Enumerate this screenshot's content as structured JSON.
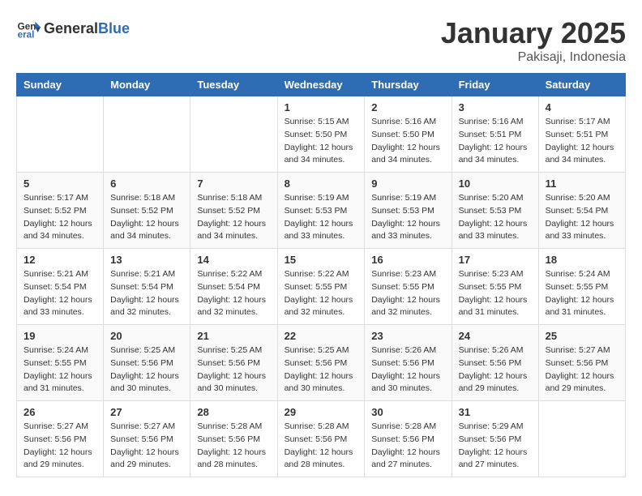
{
  "header": {
    "logo_general": "General",
    "logo_blue": "Blue",
    "title": "January 2025",
    "location": "Pakisaji, Indonesia"
  },
  "weekdays": [
    "Sunday",
    "Monday",
    "Tuesday",
    "Wednesday",
    "Thursday",
    "Friday",
    "Saturday"
  ],
  "weeks": [
    [
      {
        "day": "",
        "sunrise": "",
        "sunset": "",
        "daylight": ""
      },
      {
        "day": "",
        "sunrise": "",
        "sunset": "",
        "daylight": ""
      },
      {
        "day": "",
        "sunrise": "",
        "sunset": "",
        "daylight": ""
      },
      {
        "day": "1",
        "sunrise": "Sunrise: 5:15 AM",
        "sunset": "Sunset: 5:50 PM",
        "daylight": "Daylight: 12 hours and 34 minutes."
      },
      {
        "day": "2",
        "sunrise": "Sunrise: 5:16 AM",
        "sunset": "Sunset: 5:50 PM",
        "daylight": "Daylight: 12 hours and 34 minutes."
      },
      {
        "day": "3",
        "sunrise": "Sunrise: 5:16 AM",
        "sunset": "Sunset: 5:51 PM",
        "daylight": "Daylight: 12 hours and 34 minutes."
      },
      {
        "day": "4",
        "sunrise": "Sunrise: 5:17 AM",
        "sunset": "Sunset: 5:51 PM",
        "daylight": "Daylight: 12 hours and 34 minutes."
      }
    ],
    [
      {
        "day": "5",
        "sunrise": "Sunrise: 5:17 AM",
        "sunset": "Sunset: 5:52 PM",
        "daylight": "Daylight: 12 hours and 34 minutes."
      },
      {
        "day": "6",
        "sunrise": "Sunrise: 5:18 AM",
        "sunset": "Sunset: 5:52 PM",
        "daylight": "Daylight: 12 hours and 34 minutes."
      },
      {
        "day": "7",
        "sunrise": "Sunrise: 5:18 AM",
        "sunset": "Sunset: 5:52 PM",
        "daylight": "Daylight: 12 hours and 34 minutes."
      },
      {
        "day": "8",
        "sunrise": "Sunrise: 5:19 AM",
        "sunset": "Sunset: 5:53 PM",
        "daylight": "Daylight: 12 hours and 33 minutes."
      },
      {
        "day": "9",
        "sunrise": "Sunrise: 5:19 AM",
        "sunset": "Sunset: 5:53 PM",
        "daylight": "Daylight: 12 hours and 33 minutes."
      },
      {
        "day": "10",
        "sunrise": "Sunrise: 5:20 AM",
        "sunset": "Sunset: 5:53 PM",
        "daylight": "Daylight: 12 hours and 33 minutes."
      },
      {
        "day": "11",
        "sunrise": "Sunrise: 5:20 AM",
        "sunset": "Sunset: 5:54 PM",
        "daylight": "Daylight: 12 hours and 33 minutes."
      }
    ],
    [
      {
        "day": "12",
        "sunrise": "Sunrise: 5:21 AM",
        "sunset": "Sunset: 5:54 PM",
        "daylight": "Daylight: 12 hours and 33 minutes."
      },
      {
        "day": "13",
        "sunrise": "Sunrise: 5:21 AM",
        "sunset": "Sunset: 5:54 PM",
        "daylight": "Daylight: 12 hours and 32 minutes."
      },
      {
        "day": "14",
        "sunrise": "Sunrise: 5:22 AM",
        "sunset": "Sunset: 5:54 PM",
        "daylight": "Daylight: 12 hours and 32 minutes."
      },
      {
        "day": "15",
        "sunrise": "Sunrise: 5:22 AM",
        "sunset": "Sunset: 5:55 PM",
        "daylight": "Daylight: 12 hours and 32 minutes."
      },
      {
        "day": "16",
        "sunrise": "Sunrise: 5:23 AM",
        "sunset": "Sunset: 5:55 PM",
        "daylight": "Daylight: 12 hours and 32 minutes."
      },
      {
        "day": "17",
        "sunrise": "Sunrise: 5:23 AM",
        "sunset": "Sunset: 5:55 PM",
        "daylight": "Daylight: 12 hours and 31 minutes."
      },
      {
        "day": "18",
        "sunrise": "Sunrise: 5:24 AM",
        "sunset": "Sunset: 5:55 PM",
        "daylight": "Daylight: 12 hours and 31 minutes."
      }
    ],
    [
      {
        "day": "19",
        "sunrise": "Sunrise: 5:24 AM",
        "sunset": "Sunset: 5:55 PM",
        "daylight": "Daylight: 12 hours and 31 minutes."
      },
      {
        "day": "20",
        "sunrise": "Sunrise: 5:25 AM",
        "sunset": "Sunset: 5:56 PM",
        "daylight": "Daylight: 12 hours and 30 minutes."
      },
      {
        "day": "21",
        "sunrise": "Sunrise: 5:25 AM",
        "sunset": "Sunset: 5:56 PM",
        "daylight": "Daylight: 12 hours and 30 minutes."
      },
      {
        "day": "22",
        "sunrise": "Sunrise: 5:25 AM",
        "sunset": "Sunset: 5:56 PM",
        "daylight": "Daylight: 12 hours and 30 minutes."
      },
      {
        "day": "23",
        "sunrise": "Sunrise: 5:26 AM",
        "sunset": "Sunset: 5:56 PM",
        "daylight": "Daylight: 12 hours and 30 minutes."
      },
      {
        "day": "24",
        "sunrise": "Sunrise: 5:26 AM",
        "sunset": "Sunset: 5:56 PM",
        "daylight": "Daylight: 12 hours and 29 minutes."
      },
      {
        "day": "25",
        "sunrise": "Sunrise: 5:27 AM",
        "sunset": "Sunset: 5:56 PM",
        "daylight": "Daylight: 12 hours and 29 minutes."
      }
    ],
    [
      {
        "day": "26",
        "sunrise": "Sunrise: 5:27 AM",
        "sunset": "Sunset: 5:56 PM",
        "daylight": "Daylight: 12 hours and 29 minutes."
      },
      {
        "day": "27",
        "sunrise": "Sunrise: 5:27 AM",
        "sunset": "Sunset: 5:56 PM",
        "daylight": "Daylight: 12 hours and 29 minutes."
      },
      {
        "day": "28",
        "sunrise": "Sunrise: 5:28 AM",
        "sunset": "Sunset: 5:56 PM",
        "daylight": "Daylight: 12 hours and 28 minutes."
      },
      {
        "day": "29",
        "sunrise": "Sunrise: 5:28 AM",
        "sunset": "Sunset: 5:56 PM",
        "daylight": "Daylight: 12 hours and 28 minutes."
      },
      {
        "day": "30",
        "sunrise": "Sunrise: 5:28 AM",
        "sunset": "Sunset: 5:56 PM",
        "daylight": "Daylight: 12 hours and 27 minutes."
      },
      {
        "day": "31",
        "sunrise": "Sunrise: 5:29 AM",
        "sunset": "Sunset: 5:56 PM",
        "daylight": "Daylight: 12 hours and 27 minutes."
      },
      {
        "day": "",
        "sunrise": "",
        "sunset": "",
        "daylight": ""
      }
    ]
  ]
}
